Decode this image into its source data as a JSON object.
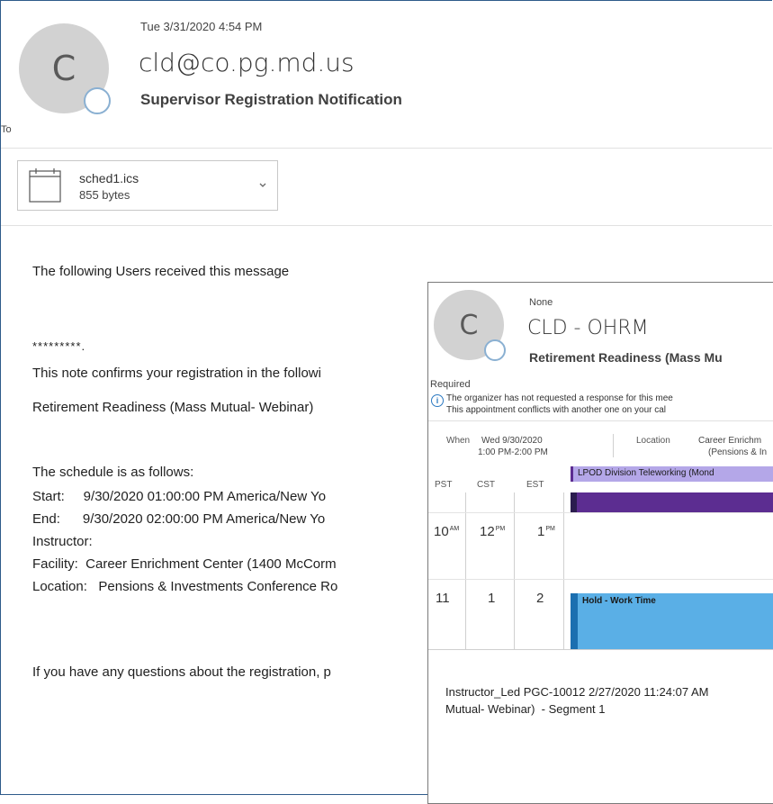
{
  "email": {
    "datetime": "Tue 3/31/2020 4:54 PM",
    "avatar_letter": "C",
    "sender": "cld@co.pg.md.us",
    "subject": "Supervisor Registration Notification",
    "to_label": "To",
    "attachment": {
      "name": "sched1.ics",
      "size": "855 bytes"
    },
    "body": {
      "line1": "The following Users received this message",
      "line2": "*********.",
      "line3": "This note confirms your registration in the followi",
      "line4": "Retirement Readiness (Mass Mutual- Webinar)",
      "line5": "The schedule is as follows:",
      "start": "Start:     9/30/2020 01:00:00 PM America/New Yo",
      "end": "End:      9/30/2020 02:00:00 PM America/New Yo",
      "instructor": "Instructor:",
      "facility": "Facility:  Career Enrichment Center (1400 McCorm",
      "location": "Location:   Pensions & Investments Conference Ro",
      "questions": "If you have any questions about the registration, p"
    }
  },
  "meeting": {
    "response": "None",
    "avatar_letter": "C",
    "organizer": "CLD - OHRM",
    "title": "Retirement Readiness (Mass Mu",
    "required_label": "Required",
    "info_line1": "The organizer has not requested a response for this mee",
    "info_line2": "This appointment conflicts with another one on your cal",
    "when_label": "When",
    "when_date": "Wed 9/30/2020",
    "when_time": "1:00 PM-2:00 PM",
    "location_label": "Location",
    "location_line1": "Career Enrichm",
    "location_line2": "(Pensions & In",
    "tz": [
      "PST",
      "CST",
      "EST"
    ],
    "all_day_event": "LPOD Division Teleworking (Mond",
    "row1": {
      "pst": "10",
      "pst_ampm": "AM",
      "cst": "12",
      "cst_ampm": "PM",
      "est": "1",
      "est_ampm": "PM"
    },
    "row2": {
      "pst": "11",
      "cst": "1",
      "est": "2"
    },
    "hold_event": "Hold - Work Time",
    "notes_line1": "Instructor_Led PGC-10012 2/27/2020 11:24:07 AM",
    "notes_line2": "Mutual- Webinar)  - Segment 1"
  },
  "colors": {
    "accent_purple": "#5c2d91",
    "lavender": "#b4a7e8",
    "hold_blue": "#5aafe6"
  }
}
